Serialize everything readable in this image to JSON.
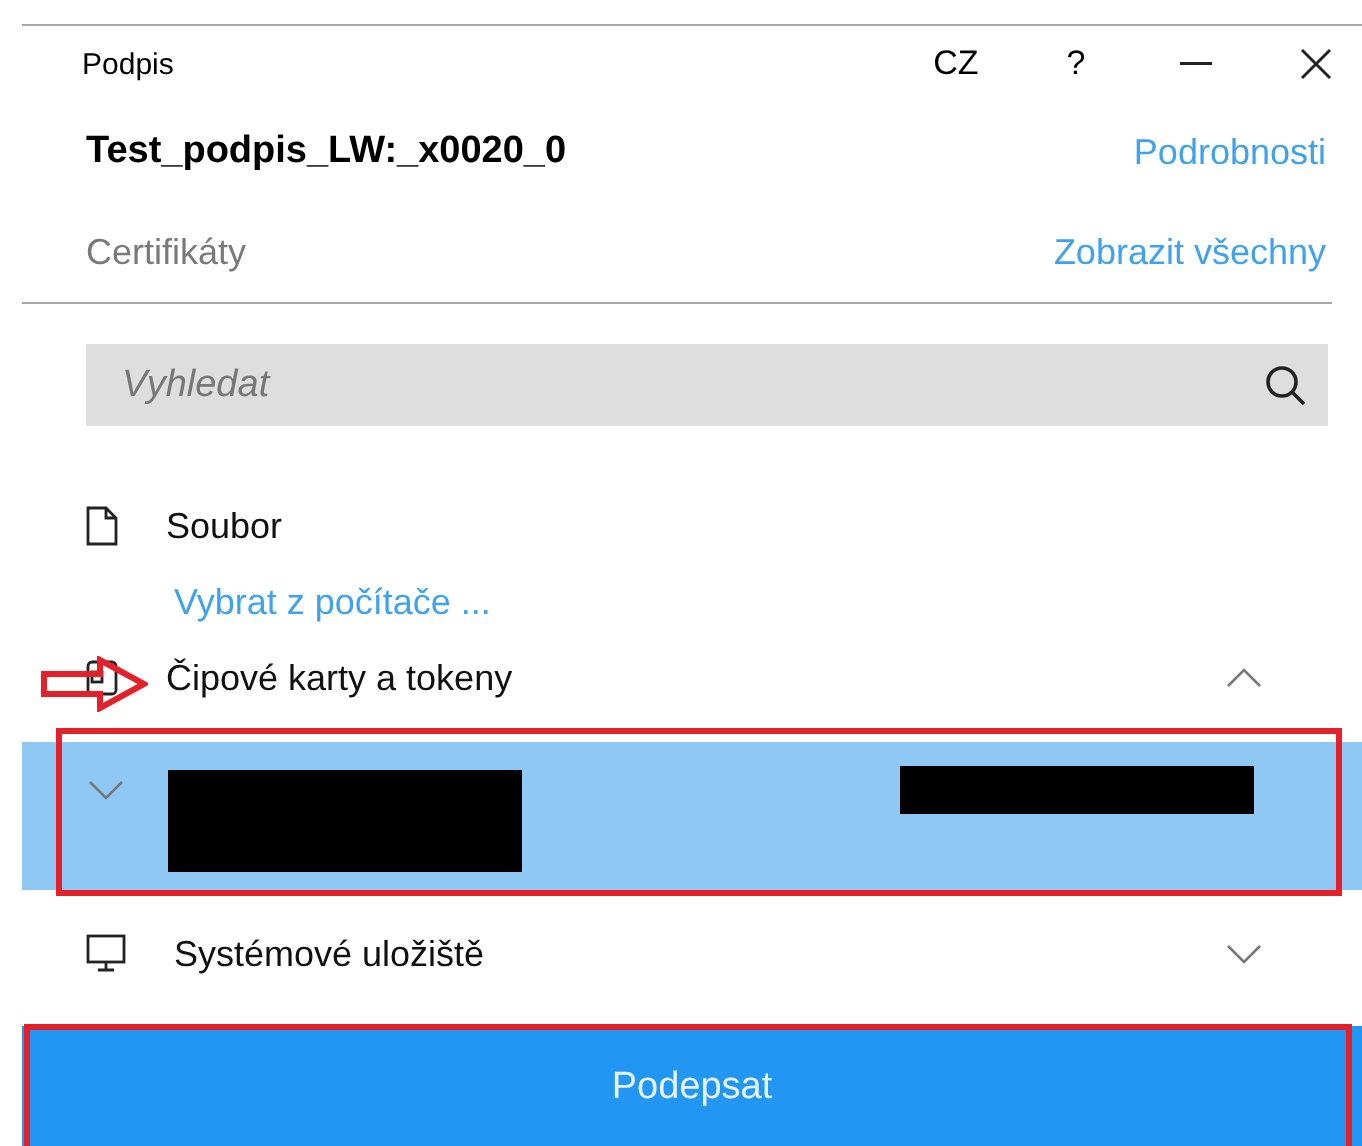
{
  "window": {
    "title": "Podpis",
    "language": "CZ",
    "help": "?"
  },
  "document": {
    "name": "Test_podpis_LW:_x0020_0",
    "details_link": "Podrobnosti"
  },
  "certificates": {
    "label": "Certifikáty",
    "show_all_link": "Zobrazit všechny"
  },
  "search": {
    "placeholder": "Vyhledat"
  },
  "sources": [
    {
      "kind": "file",
      "label": "Soubor",
      "link": "Vybrat z počítače ..."
    },
    {
      "kind": "cards",
      "label": "Čipové karty a tokeny",
      "expanded": true,
      "items": [
        {
          "selected": true,
          "expanded": false
        }
      ]
    },
    {
      "kind": "system",
      "label": "Systémové uložiště",
      "expanded": false
    }
  ],
  "sign_button": "Podepsat"
}
